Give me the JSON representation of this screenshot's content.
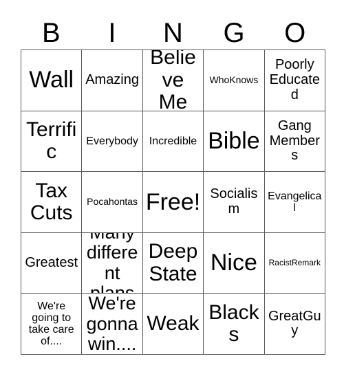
{
  "card": {
    "title_letters": [
      "B",
      "I",
      "N",
      "G",
      "O"
    ],
    "free_space": "Free!",
    "colors": {
      "background": "#ffffff",
      "text": "#000000",
      "grid_line": "#595959"
    },
    "rows": [
      [
        {
          "label": "Wall",
          "size": "xxl"
        },
        {
          "label": "Amazing",
          "size": "md"
        },
        {
          "label": "Believe Me",
          "size": "xl"
        },
        {
          "label": "WhoKnows",
          "size": "xs"
        },
        {
          "label": "Poorly Educated",
          "size": "md"
        }
      ],
      [
        {
          "label": "Terrific",
          "size": "xl"
        },
        {
          "label": "Everybody",
          "size": "sm"
        },
        {
          "label": "Incredible",
          "size": "sm"
        },
        {
          "label": "Bible",
          "size": "xxl"
        },
        {
          "label": "Gang Members",
          "size": "md"
        }
      ],
      [
        {
          "label": "Tax Cuts",
          "size": "xl"
        },
        {
          "label": "Pocahontas",
          "size": "xs"
        },
        {
          "label": "Free!",
          "size": "xxl"
        },
        {
          "label": "Socialism",
          "size": "md"
        },
        {
          "label": "Evangelical",
          "size": "sm"
        }
      ],
      [
        {
          "label": "Greatest",
          "size": "md"
        },
        {
          "label": "Many different plans",
          "size": "lg"
        },
        {
          "label": "Deep State",
          "size": "xl"
        },
        {
          "label": "Nice",
          "size": "xxl"
        },
        {
          "label": "RacistRemark",
          "size": "xxs"
        }
      ],
      [
        {
          "label": "We're going to take care of....",
          "size": "sm"
        },
        {
          "label": "We're gonna win....",
          "size": "lg"
        },
        {
          "label": "Weak",
          "size": "xl"
        },
        {
          "label": "Blacks",
          "size": "xl"
        },
        {
          "label": "GreatGuy",
          "size": "md"
        }
      ]
    ]
  }
}
